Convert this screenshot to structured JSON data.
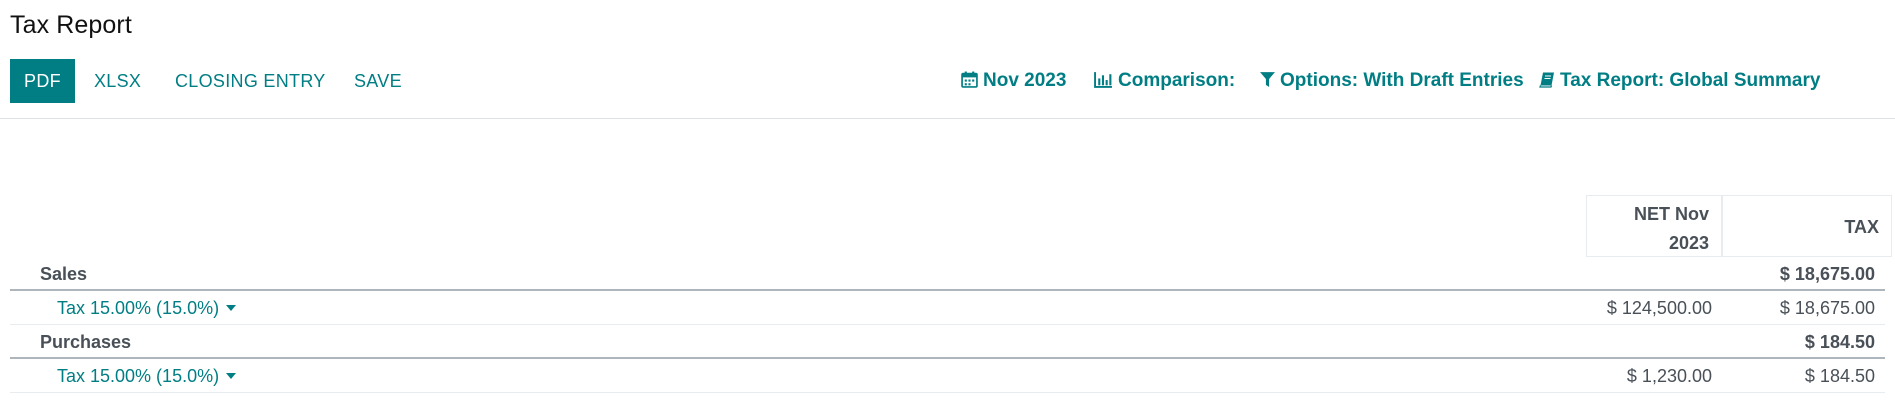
{
  "header": {
    "title": "Tax Report",
    "buttons": {
      "pdf": "PDF",
      "xlsx": "XLSX",
      "closing_entry": "CLOSING ENTRY",
      "save": "SAVE"
    },
    "filters": {
      "date": "Nov 2023",
      "comparison": "Comparison:",
      "options": "Options: With Draft Entries",
      "report": "Tax Report: Global Summary"
    }
  },
  "table": {
    "columns": {
      "net_line1": "NET Nov",
      "net_line2": "2023",
      "tax": "TAX"
    },
    "rows": [
      {
        "label": "Sales",
        "net": "",
        "tax": "$ 18,675.00"
      },
      {
        "label": "Tax 15.00% (15.0%)",
        "net": "$ 124,500.00",
        "tax": "$ 18,675.00"
      },
      {
        "label": "Purchases",
        "net": "",
        "tax": "$ 184.50"
      },
      {
        "label": "Tax 15.00% (15.0%)",
        "net": "$ 1,230.00",
        "tax": "$ 184.50"
      }
    ]
  },
  "colors": {
    "primary": "#017e84",
    "text_muted": "#495057"
  },
  "icons": {
    "date": "calendar-icon",
    "comparison": "bar-chart-icon",
    "options": "filter-icon",
    "report": "book-icon",
    "line_toggle": "caret-down-icon"
  }
}
